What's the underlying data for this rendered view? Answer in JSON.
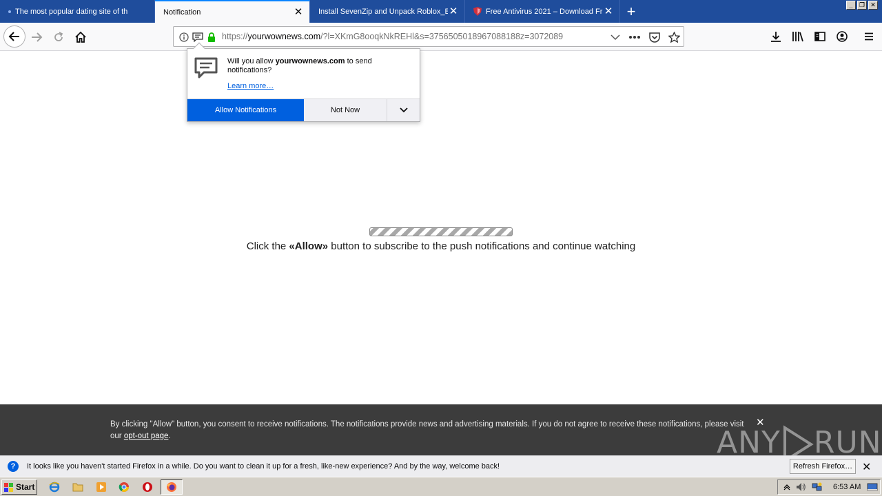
{
  "tabs": [
    {
      "title": "The most popular dating site of th",
      "active": false
    },
    {
      "title": "Notification",
      "active": true
    },
    {
      "title": "Install SevenZip and Unpack Roblox_E",
      "active": false
    },
    {
      "title": "Free Antivirus 2021 – Download Fr",
      "active": false
    }
  ],
  "window_controls": {
    "minimize": "_",
    "restore": "❐",
    "close": "✕"
  },
  "url": {
    "prefix": "https://",
    "domain": "yourwownews.com",
    "rest": "/?l=XKmG8ooqkNkREHl&s=3756505018967088188z=3072089"
  },
  "notification_prompt": {
    "msg_before": "Will you allow ",
    "site": "yourwownews.com",
    "msg_after": " to send notifications?",
    "learn_more": "Learn more…",
    "allow_label": "Allow Notifications",
    "not_now_label": "Not Now"
  },
  "page": {
    "msg_before": "Click the ",
    "msg_bold": "«Allow»",
    "msg_after": " button to subscribe to the push notifications and continue watching"
  },
  "consent": {
    "text": "By clicking \"Allow\" button, you consent to receive notifications. The notifications provide news and advertising materials. If you do not agree to receive these notifications, please visit our ",
    "link": "opt-out page",
    "end": ".",
    "close": "✕"
  },
  "watermark": {
    "left": "ANY",
    "right": "RUN"
  },
  "notification_bar": {
    "icon": "?",
    "text": "It looks like you haven't started Firefox in a while. Do you want to clean it up for a fresh, like-new experience? And by the way, welcome back!",
    "button": "Refresh Firefox…",
    "close": "✕"
  },
  "taskbar": {
    "start": "Start",
    "clock": "6:53 AM"
  },
  "colors": {
    "tab_strip": "#1f4d9c",
    "accent": "#0060df",
    "banner": "#3c3c3c"
  }
}
